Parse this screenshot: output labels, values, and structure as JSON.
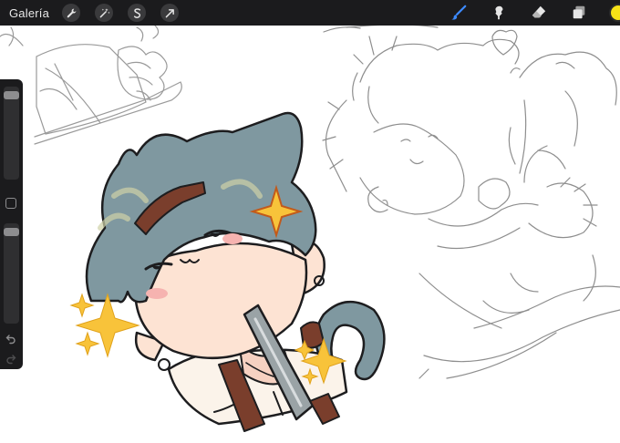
{
  "toolbar": {
    "gallery_label": "Galería",
    "left_tools": [
      "wrench-icon",
      "magic-wand-icon",
      "selection-icon",
      "transform-arrow-icon"
    ],
    "right_tools": [
      "brush-icon",
      "smudge-icon",
      "eraser-icon",
      "layers-icon"
    ],
    "active_tool": "brush",
    "accent_color": "#3d8bff",
    "current_color": "#f7e217"
  },
  "sidebar": {
    "brush_size_level": 0.95,
    "opacity_level": 0.95,
    "undo_icon": "undo-icon",
    "redo_icon": "redo-icon"
  },
  "canvas": {
    "colors": {
      "hair": "#7f98a0",
      "skin": "#fde3d3",
      "blush": "#f6b3b0",
      "sparkle": "#f8c33a",
      "strap": "#7a3e2c",
      "sketch_line": "#9a9a9a",
      "outline": "#1d1d1f"
    }
  }
}
